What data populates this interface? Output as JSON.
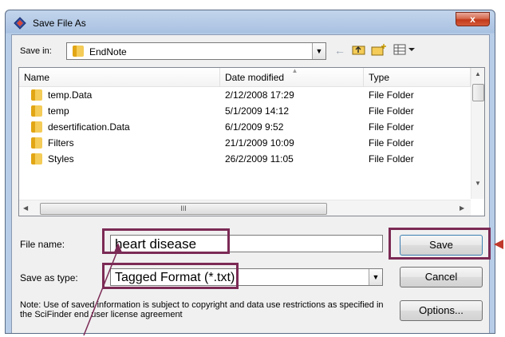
{
  "window": {
    "title": "Save File As",
    "close_glyph": "x"
  },
  "toolbar": {
    "save_in_label": "Save in:",
    "save_in_value": "EndNote",
    "icons": [
      "back-arrow-icon",
      "up-folder-icon",
      "new-folder-icon",
      "view-menu-icon"
    ]
  },
  "file_list": {
    "columns": [
      "Name",
      "Date modified",
      "Type"
    ],
    "rows": [
      {
        "name": "temp.Data",
        "date": "2/12/2008 17:29",
        "type": "File Folder"
      },
      {
        "name": "temp",
        "date": "5/1/2009 14:12",
        "type": "File Folder"
      },
      {
        "name": "desertification.Data",
        "date": "6/1/2009 9:52",
        "type": "File Folder"
      },
      {
        "name": "Filters",
        "date": "21/1/2009 10:09",
        "type": "File Folder"
      },
      {
        "name": "Styles",
        "date": "26/2/2009 11:05",
        "type": "File Folder"
      }
    ],
    "hscroll_grip": "III"
  },
  "form": {
    "file_name_label": "File name:",
    "file_name_value": "heart disease",
    "save_as_type_label": "Save as type:",
    "save_as_type_value": "Tagged Format (*.txt)",
    "note": "Note: Use of saved information is subject to copyright and data use restrictions as specified in the SciFinder end user license agreement"
  },
  "buttons": {
    "save": "Save",
    "cancel": "Cancel",
    "options": "Options..."
  },
  "colors": {
    "highlight": "#7b2a55",
    "title_bar": "#b9cde8",
    "close_button": "#c84a2c",
    "folder": "#f4cc57"
  }
}
